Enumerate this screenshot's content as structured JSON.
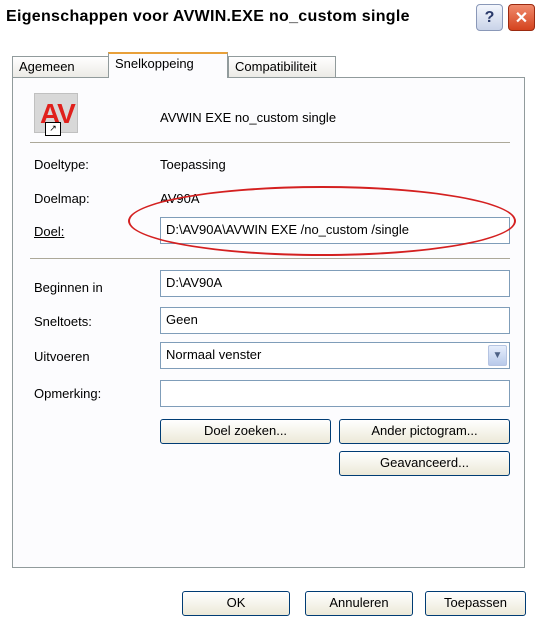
{
  "window": {
    "title": "Eigenschappen voor AVWIN.EXE no_custom single"
  },
  "icons": {
    "help": "help-question-icon",
    "close": "close-x-icon",
    "app": "av-application-icon",
    "shortcut": "shortcut-arrow-icon"
  },
  "tabs": [
    {
      "label": "Agemeen",
      "active": false
    },
    {
      "label": "Snelkoppeing",
      "active": true
    },
    {
      "label": "Compatibiliteit",
      "active": false
    }
  ],
  "app": {
    "icon_text": "AV",
    "shortcut_glyph": "↗",
    "name": "AVWIN EXE no_custom single"
  },
  "fields": {
    "doeltype_label": "Doeltype:",
    "doeltype_value": "Toepassing",
    "doelmap_label": "Doelmap:",
    "doelmap_value": "AV90A",
    "doel_label": "Doel:",
    "doel_value": "D:\\AV90A\\AVWIN EXE /no_custom /single",
    "beginnen_label": "Beginnen in",
    "beginnen_value": "D:\\AV90A",
    "sneltoets_label": "Sneltoets:",
    "sneltoets_value": "Geen",
    "uitvoeren_label": "Uitvoeren",
    "uitvoeren_value": "Normaal venster",
    "opmerking_label": "Opmerking:",
    "opmerking_value": ""
  },
  "buttons": {
    "doel_zoeken": "Doel zoeken...",
    "ander_pictogram": "Ander pictogram...",
    "geavanceerd": "Geavanceerd...",
    "ok": "OK",
    "annuleren": "Annuleren",
    "toepassen": "Toepassen"
  },
  "colors": {
    "highlight": "#d42020",
    "tab_accent": "#e8a03a",
    "close_button": "#d4431e"
  }
}
